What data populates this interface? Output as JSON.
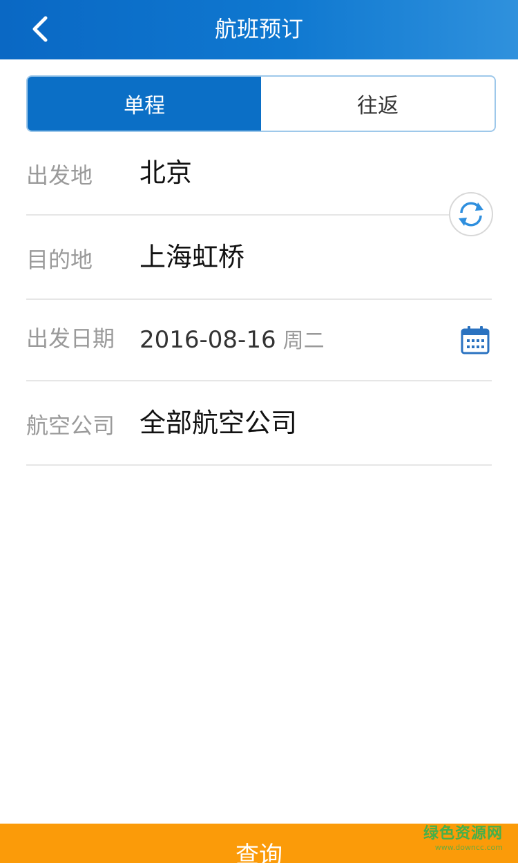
{
  "header": {
    "title": "航班预订",
    "back_icon": "chevron-left-icon",
    "background_color": "#0b6fc6"
  },
  "trip_type": {
    "options": [
      "单程",
      "往返"
    ],
    "selected": "单程"
  },
  "form": {
    "departure": {
      "label": "出发地",
      "value": "北京"
    },
    "destination": {
      "label": "目的地",
      "value": "上海虹桥"
    },
    "date": {
      "label": "出发日期",
      "value": "2016-08-16",
      "weekday": "周二",
      "icon": "calendar-icon"
    },
    "airline": {
      "label": "航空公司",
      "value": "全部航空公司"
    },
    "swap_icon": "swap-icon"
  },
  "search_button": {
    "label": "查询",
    "color": "#fb9b09"
  },
  "watermark": {
    "title": "绿色资源网",
    "url": "www.downcc.com",
    "color": "#46b04a"
  }
}
